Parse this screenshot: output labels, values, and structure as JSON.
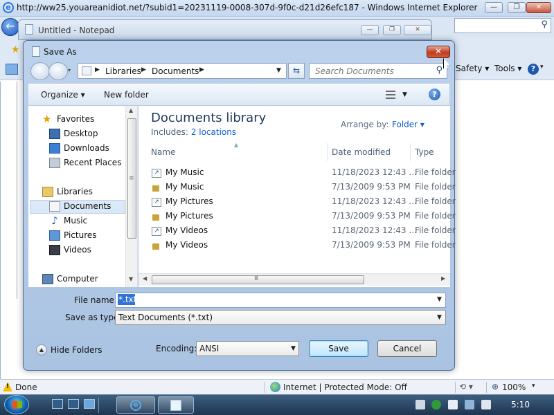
{
  "ie": {
    "title": "http://ww25.youareanidiot.net/?subid1=20231119-0008-307d-9f0c-d21d26efc187 - Windows Internet Explorer",
    "menu_safety": "Safety",
    "menu_tools": "Tools",
    "status_text": "Done",
    "zone_text": "Internet | Protected Mode: Off",
    "zoom": "100%"
  },
  "notepad": {
    "title": "Untitled - Notepad"
  },
  "dialog": {
    "title": "Save As",
    "breadcrumb": [
      "Libraries",
      "Documents"
    ],
    "search_placeholder": "Search Documents",
    "toolbar": {
      "organize": "Organize",
      "new_folder": "New folder"
    },
    "nav": {
      "favorites": "Favorites",
      "desktop": "Desktop",
      "downloads": "Downloads",
      "recent_places": "Recent Places",
      "libraries": "Libraries",
      "documents": "Documents",
      "music": "Music",
      "pictures": "Pictures",
      "videos": "Videos",
      "computer": "Computer"
    },
    "library": {
      "title": "Documents library",
      "includes_label": "Includes:",
      "includes_link": "2 locations",
      "arrange_label": "Arrange by:",
      "arrange_value": "Folder"
    },
    "columns": {
      "name": "Name",
      "date": "Date modified",
      "type": "Type"
    },
    "rows": [
      {
        "name": "My Music",
        "date": "11/18/2023 12:43 ...",
        "type": "File folder",
        "kind": "shortcut"
      },
      {
        "name": "My Music",
        "date": "7/13/2009 9:53 PM",
        "type": "File folder",
        "kind": "locked"
      },
      {
        "name": "My Pictures",
        "date": "11/18/2023 12:43 ...",
        "type": "File folder",
        "kind": "shortcut"
      },
      {
        "name": "My Pictures",
        "date": "7/13/2009 9:53 PM",
        "type": "File folder",
        "kind": "locked"
      },
      {
        "name": "My Videos",
        "date": "11/18/2023 12:43 ...",
        "type": "File folder",
        "kind": "shortcut"
      },
      {
        "name": "My Videos",
        "date": "7/13/2009 9:53 PM",
        "type": "File folder",
        "kind": "locked"
      }
    ],
    "file_name_label": "File name:",
    "file_name_value": "*.txt",
    "save_as_type_label": "Save as type:",
    "save_as_type_value": "Text Documents (*.txt)",
    "hide_folders": "Hide Folders",
    "encoding_label": "Encoding:",
    "encoding_value": "ANSI",
    "save_button": "Save",
    "cancel_button": "Cancel"
  },
  "taskbar": {
    "clock": "5:10"
  },
  "colors": {
    "accent": "#0a5ecf",
    "selection": "#3373d6",
    "close_red": "#c13a1e"
  }
}
